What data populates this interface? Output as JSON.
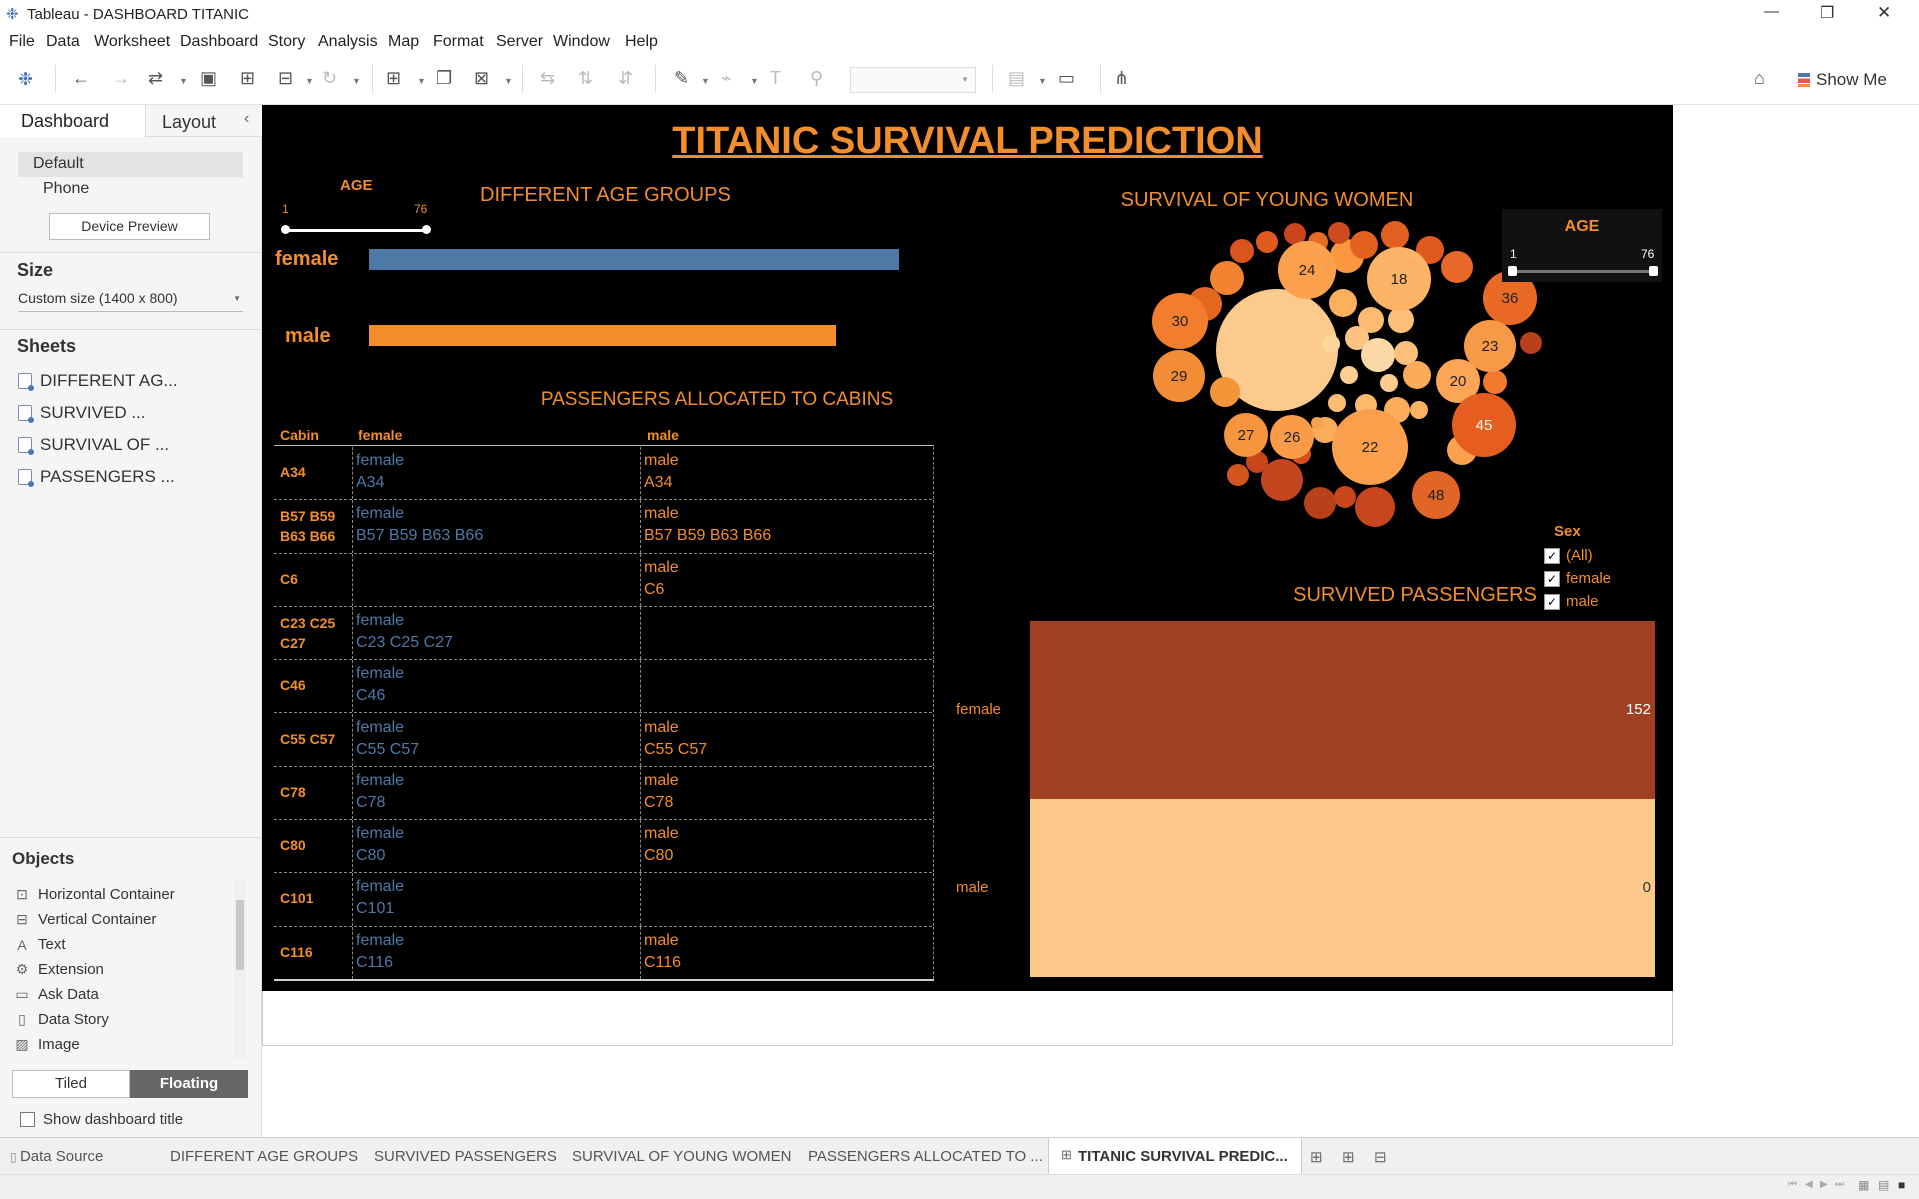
{
  "window": {
    "title": "Tableau - DASHBOARD TITANIC",
    "minimize": "—",
    "maximize": "❐",
    "close": "✕"
  },
  "menu": [
    "File",
    "Data",
    "Worksheet",
    "Dashboard",
    "Story",
    "Analysis",
    "Map",
    "Format",
    "Server",
    "Window",
    "Help"
  ],
  "toolbar": {
    "show_me": "Show Me"
  },
  "left_panel": {
    "tabs": {
      "dashboard": "Dashboard",
      "layout": "Layout"
    },
    "devices": {
      "default": "Default",
      "phone": "Phone",
      "preview_button": "Device Preview"
    },
    "size": {
      "heading": "Size",
      "value": "Custom size (1400 x 800)"
    },
    "sheets": {
      "heading": "Sheets",
      "items": [
        "DIFFERENT AG...",
        "SURVIVED ...",
        "SURVIVAL OF ...",
        "PASSENGERS ..."
      ]
    },
    "objects": {
      "heading": "Objects",
      "items": [
        {
          "label": "Horizontal Container",
          "icon": "horizontal-container-icon"
        },
        {
          "label": "Vertical Container",
          "icon": "vertical-container-icon"
        },
        {
          "label": "Text",
          "icon": "text-icon"
        },
        {
          "label": "Extension",
          "icon": "extension-icon"
        },
        {
          "label": "Ask Data",
          "icon": "ask-data-icon"
        },
        {
          "label": "Data Story",
          "icon": "data-story-icon"
        },
        {
          "label": "Image",
          "icon": "image-icon"
        }
      ]
    },
    "layout_mode": {
      "tiled": "Tiled",
      "floating": "Floating"
    },
    "show_title": "Show dashboard title"
  },
  "dashboard": {
    "title": "TITANIC SURVIVAL PREDICTION",
    "age_filter_left": {
      "label": "AGE",
      "min": "1",
      "max": "76"
    },
    "age_filter_right": {
      "label": "AGE",
      "min": "1",
      "max": "76"
    },
    "age_groups": {
      "title": "DIFFERENT AGE GROUPS",
      "colors": {
        "female": "#4e79a7",
        "male": "#f28e2b"
      }
    },
    "cabins": {
      "title": "PASSENGERS ALLOCATED TO CABINS",
      "headers": [
        "Cabin",
        "female",
        "male"
      ],
      "rows": [
        {
          "cabin": "A34",
          "female": [
            "female",
            "A34"
          ],
          "male": [
            "male",
            "A34"
          ]
        },
        {
          "cabin": "B57 B59 B63 B66",
          "female": [
            "female",
            "B57 B59 B63 B66"
          ],
          "male": [
            "male",
            "B57 B59 B63 B66"
          ]
        },
        {
          "cabin": "C6",
          "female": [
            "",
            ""
          ],
          "male": [
            "male",
            "C6"
          ]
        },
        {
          "cabin": "C23 C25 C27",
          "female": [
            "female",
            "C23 C25 C27"
          ],
          "male": [
            "",
            ""
          ]
        },
        {
          "cabin": "C46",
          "female": [
            "female",
            "C46"
          ],
          "male": [
            "",
            ""
          ]
        },
        {
          "cabin": "C55 C57",
          "female": [
            "female",
            "C55 C57"
          ],
          "male": [
            "male",
            "C55 C57"
          ]
        },
        {
          "cabin": "C78",
          "female": [
            "female",
            "C78"
          ],
          "male": [
            "male",
            "C78"
          ]
        },
        {
          "cabin": "C80",
          "female": [
            "female",
            "C80"
          ],
          "male": [
            "male",
            "C80"
          ]
        },
        {
          "cabin": "C101",
          "female": [
            "female",
            "C101"
          ],
          "male": [
            "",
            ""
          ]
        },
        {
          "cabin": "C116",
          "female": [
            "female",
            "C116"
          ],
          "male": [
            "male",
            "C116"
          ]
        }
      ]
    },
    "young_women": {
      "title": "SURVIVAL OF YOUNG WOMEN"
    },
    "survived": {
      "title": "SURVIVED PASSENGERS"
    },
    "sex_legend": {
      "title": "Sex",
      "items": [
        "(All)",
        "female",
        "male"
      ]
    }
  },
  "chart_data": [
    {
      "type": "bar",
      "categories": [
        "female",
        "male"
      ],
      "values": [
        0.93,
        0.82
      ]
    },
    {
      "type": "scatter",
      "labels": [
        "24",
        "18",
        "36",
        "30",
        "23",
        "29",
        "20",
        "27",
        "26",
        "22",
        "45",
        "48"
      ]
    },
    {
      "type": "bar",
      "categories": [
        "female",
        "male"
      ],
      "values": [
        152,
        0
      ]
    }
  ],
  "bottom_tabs": [
    "Data Source",
    "DIFFERENT AGE GROUPS",
    "SURVIVED PASSENGERS",
    "SURVIVAL OF YOUNG WOMEN",
    "PASSENGERS ALLOCATED TO ...",
    "TITANIC SURVIVAL PREDIC..."
  ]
}
